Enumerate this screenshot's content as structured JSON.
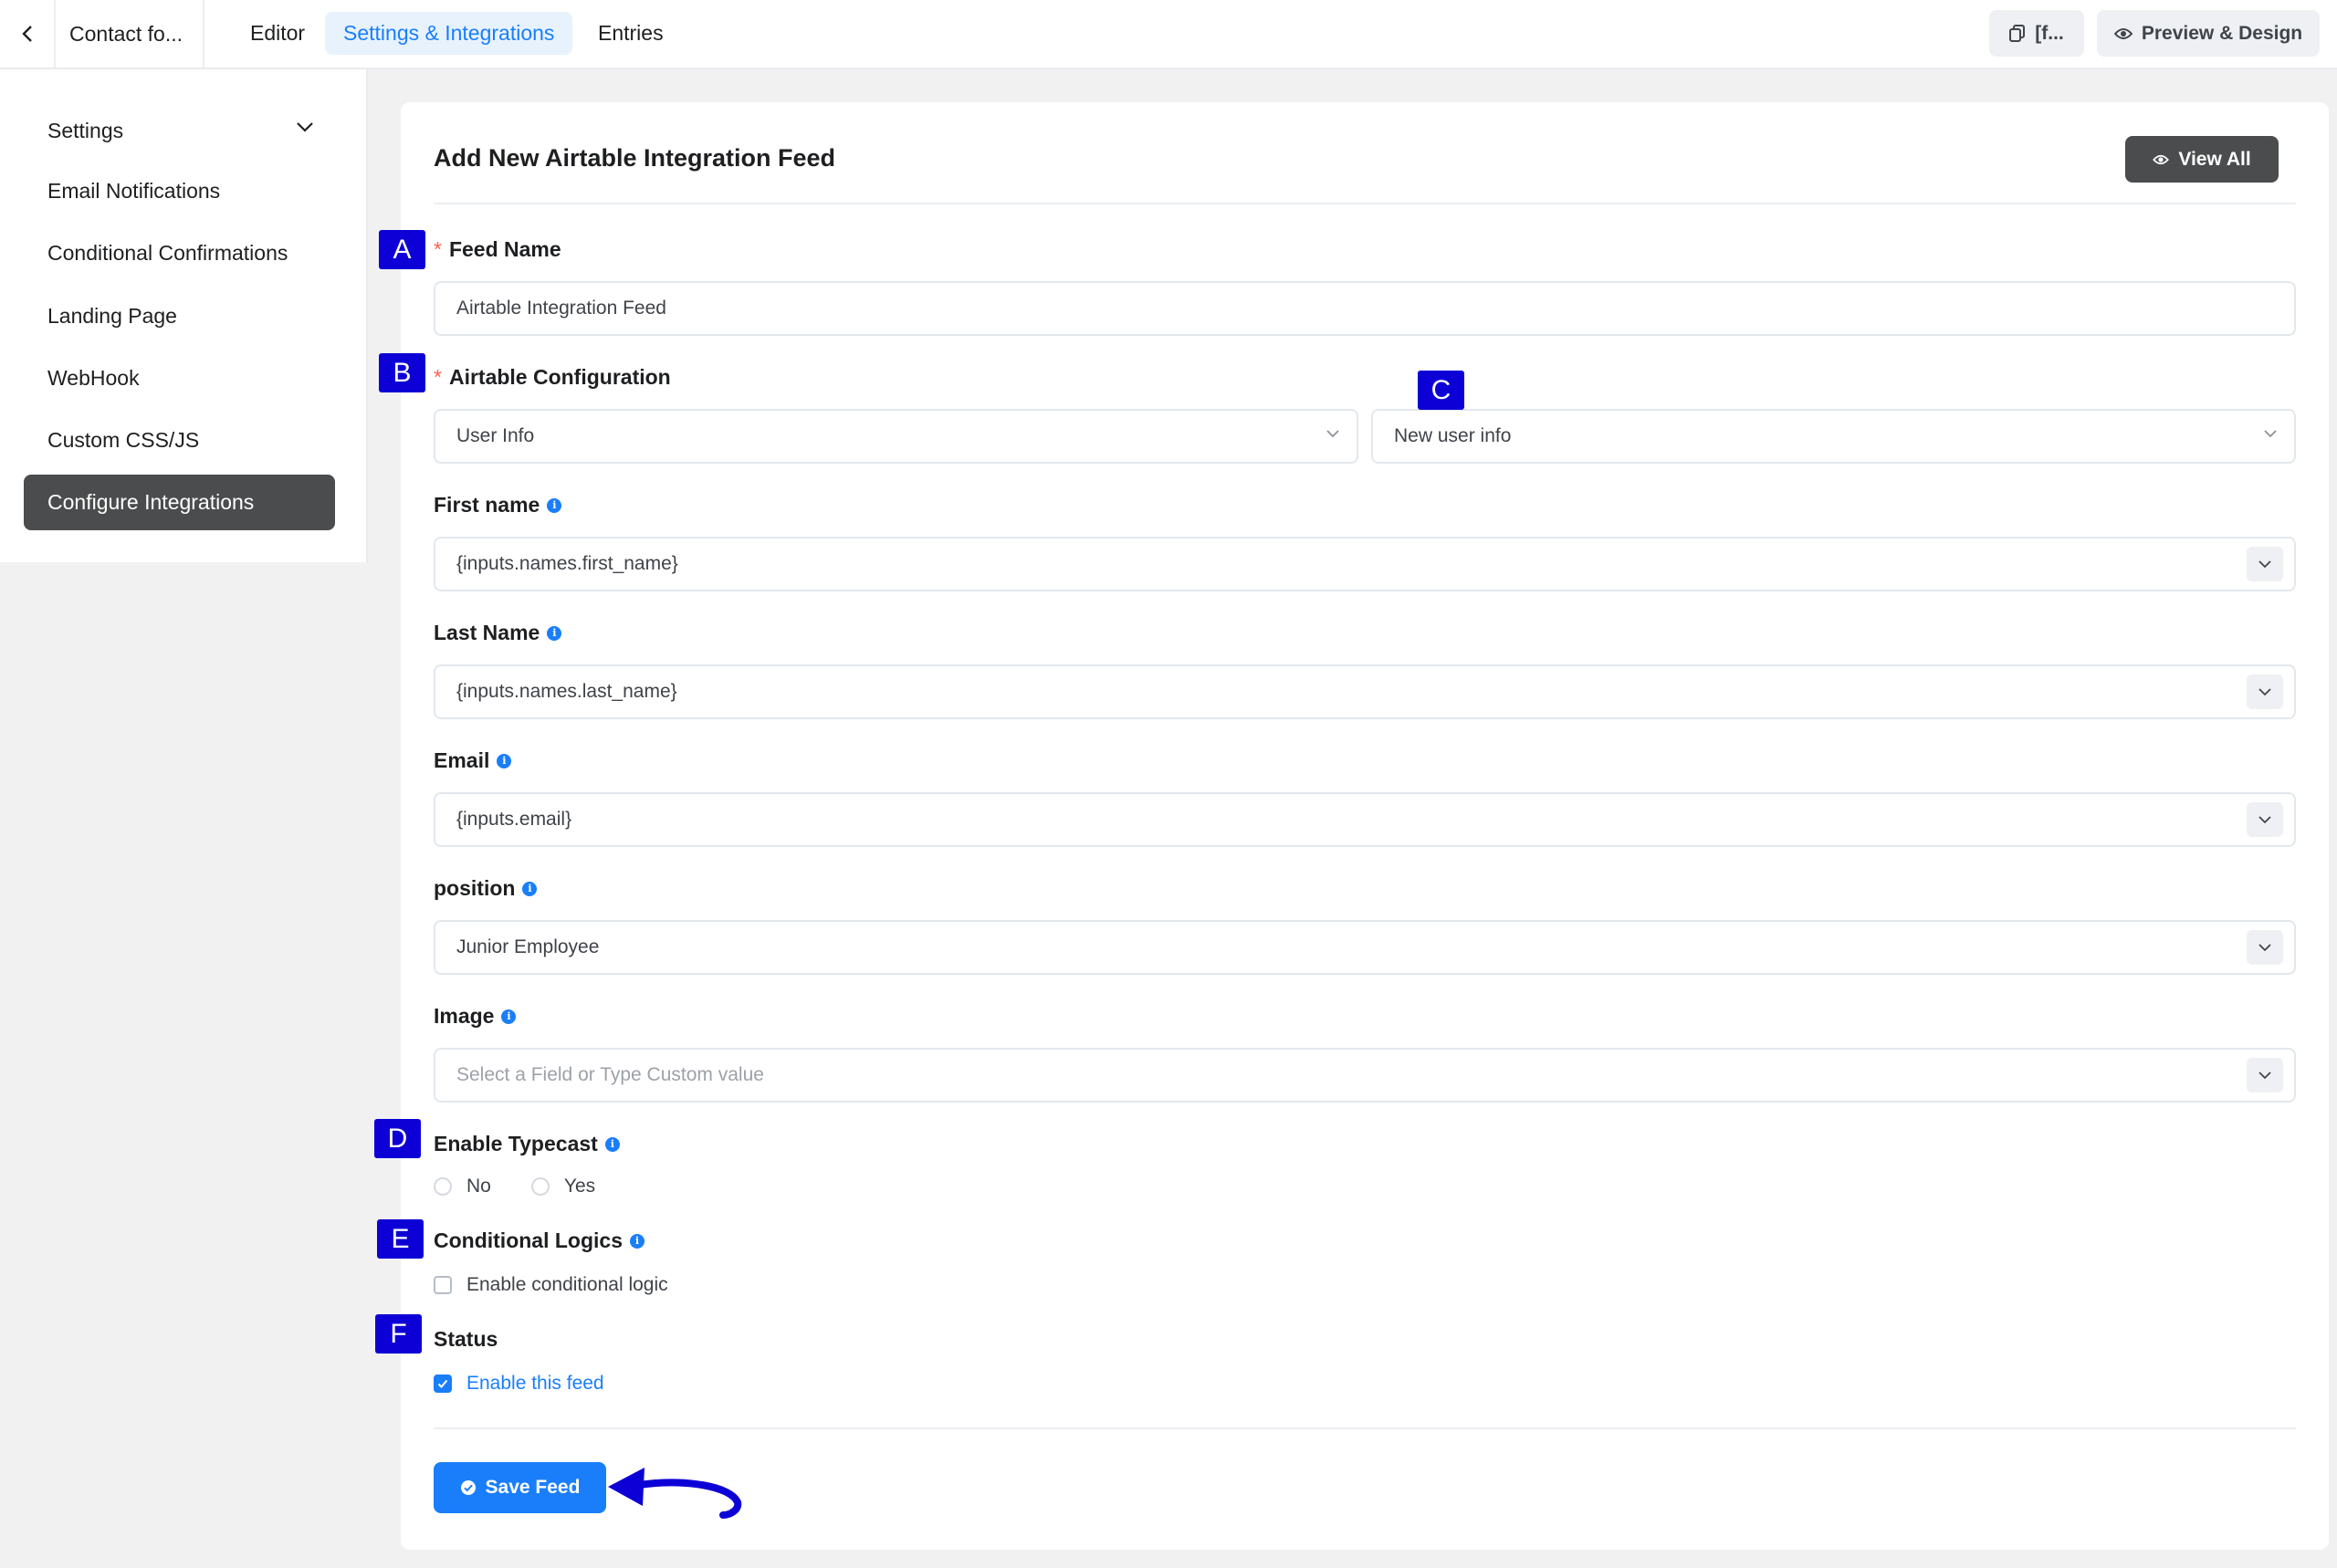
{
  "topbar": {
    "form_name": "Contact fo...",
    "tabs": [
      {
        "label": "Editor"
      },
      {
        "label": "Settings & Integrations"
      },
      {
        "label": "Entries"
      }
    ],
    "shortcode_label": "[f...",
    "preview_label": "Preview & Design"
  },
  "sidebar": {
    "items": [
      {
        "label": "Settings"
      },
      {
        "label": "Email Notifications"
      },
      {
        "label": "Conditional Confirmations"
      },
      {
        "label": "Landing Page"
      },
      {
        "label": "WebHook"
      },
      {
        "label": "Custom CSS/JS"
      },
      {
        "label": "Configure Integrations"
      }
    ]
  },
  "main": {
    "title": "Add New Airtable Integration Feed",
    "view_all_label": "View All",
    "feed_name": {
      "label": "Feed Name",
      "value": "Airtable Integration Feed"
    },
    "airtable_config": {
      "label": "Airtable Configuration",
      "base_value": "User Info",
      "table_value": "New user info"
    },
    "fields": [
      {
        "label": "First name",
        "value": "{inputs.names.first_name}"
      },
      {
        "label": "Last Name",
        "value": "{inputs.names.last_name}"
      },
      {
        "label": "Email",
        "value": "{inputs.email}"
      },
      {
        "label": "position",
        "value": "Junior Employee"
      },
      {
        "label": "Image",
        "placeholder": "Select a Field or Type Custom value"
      }
    ],
    "typecast": {
      "label": "Enable Typecast",
      "options": [
        "No",
        "Yes"
      ]
    },
    "conditional": {
      "label": "Conditional Logics",
      "checkbox_label": "Enable conditional logic"
    },
    "status": {
      "label": "Status",
      "checkbox_label": "Enable this feed"
    },
    "save_label": "Save Feed"
  },
  "annotations": [
    "A",
    "B",
    "C",
    "D",
    "E",
    "F"
  ],
  "colors": {
    "accent": "#1a7efb",
    "annotation": "#0d00d6",
    "dark_button": "#4b4c4d",
    "required": "#ff6154"
  }
}
